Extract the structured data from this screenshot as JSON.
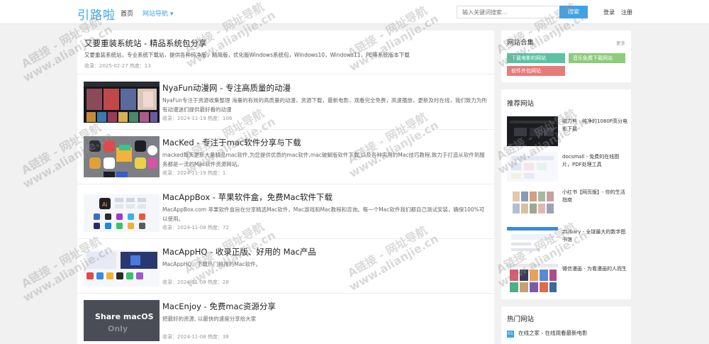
{
  "header": {
    "logo": "引路啦",
    "nav_home": "首页",
    "nav_guide": "网站导航 ▾",
    "search_placeholder": "输入关键词搜索...",
    "search_button": "搜索",
    "login": "登录",
    "register": "注册"
  },
  "featured": {
    "title": "又要重装系统站 - 精品系统包分享",
    "desc": "又要重装系统站，专业系统下载站，提供各种纯净版，精简版，优化版Windows系统包，Windows10，Windows11，PE等系统版本下载",
    "meta": "收录：2025-02-27   热度：13"
  },
  "items": [
    {
      "title": "NyaFun动漫网 - 专注高质量的动漫",
      "desc": "NyaFun专注于资源收集整理 海量的有效的高质量的动漫，资源下载，最新电影，观看完全免费，高速播放，更新及时在线，我们致力为所有动漫迷们提供最好看的动漫",
      "meta": "收录：2024-11-19   热度：106"
    },
    {
      "title": "MacKed - 专注于mac软件分享与下载",
      "desc": "macked每天更新大量精品mac软件,为您提供优质的mac软件,mac破解版软件下载,以及各种实用的Mac技巧教程,致力于打造从软件到服务都是一流的Mac软件资源网站。",
      "meta": "收录：2024-11-19   热度：1"
    },
    {
      "title": "MacAppBox - 苹果软件盒，免费Mac软件下载",
      "desc": "MacAppBox.com 苹果软件盒旨在分享精选Mac软件，Mac游戏和Mac教程和咨询。每一个Mac软件我们都自己测试安装，确保100%可以使用。",
      "meta": "收录：2024-11-08   热度：72"
    },
    {
      "title": "MacAppHQ - 收录正版、好用的 Mac产品",
      "desc": "MacAppHQ，下载热门好用的Mac软件。",
      "meta": "收录：2024-11-08   热度：28"
    },
    {
      "title": "MacEnjoy - 免费mac资源分享",
      "desc": "把最好的资源, 以最快的速度分享给大家",
      "meta": "收录：2024-11-08   热度：38"
    }
  ],
  "sidebar": {
    "collection_title": "网站合集",
    "collection_more": "更多",
    "tags": [
      {
        "label": "下载电影的网站",
        "color": "#5bc3a2"
      },
      {
        "label": "音乐免费下载网站",
        "color": "#8ccc7a"
      },
      {
        "label": "软件外包网站",
        "color": "#e87a7a"
      }
    ],
    "recommend_title": "推荐网站",
    "recommend": [
      {
        "text": "磁力熊 - 纯净的1080P高分电影下载"
      },
      {
        "text": "docsmall - 免费的在线图片，PDF处理工具"
      },
      {
        "text": "小红书【网页版】- 你的生活指南"
      },
      {
        "text": "ZLibary - 全球最大的数字图书馆"
      },
      {
        "text": "微信漫画 - 为看漫画的人而生"
      }
    ],
    "hot_title": "热门网站",
    "hot": [
      {
        "num": "01",
        "text": "在线之家 - 在线观看最新电影"
      }
    ]
  },
  "watermark": {
    "line1": "A链接 - 网址导航",
    "line2": "www.alianjie.cn"
  }
}
